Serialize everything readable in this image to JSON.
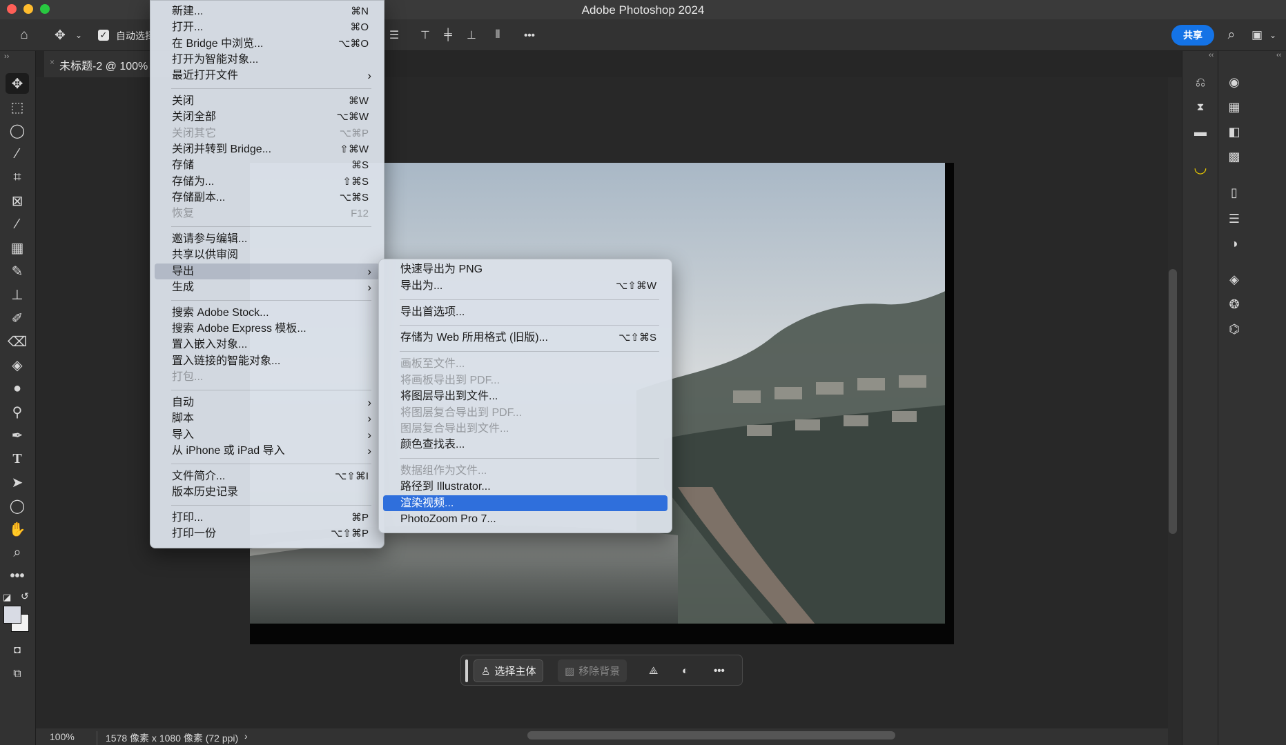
{
  "window": {
    "title": "Adobe Photoshop 2024"
  },
  "options_bar": {
    "auto_select_label": "自动选择",
    "more_label": "•••",
    "share_label": "共享"
  },
  "document_tab": {
    "title": "未标题-2 @ 100%"
  },
  "file_menu": {
    "items": [
      {
        "label": "新建...",
        "shortcut": "⌘N"
      },
      {
        "label": "打开...",
        "shortcut": "⌘O"
      },
      {
        "label": "在 Bridge 中浏览...",
        "shortcut": "⌥⌘O"
      },
      {
        "label": "打开为智能对象..."
      },
      {
        "label": "最近打开文件",
        "submenu": true
      },
      {
        "label": "关闭",
        "shortcut": "⌘W"
      },
      {
        "label": "关闭全部",
        "shortcut": "⌥⌘W"
      },
      {
        "label": "关闭其它",
        "shortcut": "⌥⌘P",
        "disabled": true
      },
      {
        "label": "关闭并转到 Bridge...",
        "shortcut": "⇧⌘W"
      },
      {
        "label": "存储",
        "shortcut": "⌘S"
      },
      {
        "label": "存储为...",
        "shortcut": "⇧⌘S"
      },
      {
        "label": "存储副本...",
        "shortcut": "⌥⌘S"
      },
      {
        "label": "恢复",
        "shortcut": "F12",
        "disabled": true
      },
      {
        "label": "邀请参与编辑..."
      },
      {
        "label": "共享以供审阅"
      },
      {
        "label": "导出",
        "submenu": true,
        "highlighted": true
      },
      {
        "label": "生成",
        "submenu": true
      },
      {
        "label": "搜索 Adobe Stock..."
      },
      {
        "label": "搜索 Adobe Express 模板..."
      },
      {
        "label": "置入嵌入对象..."
      },
      {
        "label": "置入链接的智能对象..."
      },
      {
        "label": "打包...",
        "disabled": true
      },
      {
        "label": "自动",
        "submenu": true
      },
      {
        "label": "脚本",
        "submenu": true
      },
      {
        "label": "导入",
        "submenu": true
      },
      {
        "label": "从 iPhone 或 iPad 导入",
        "submenu": true
      },
      {
        "label": "文件简介...",
        "shortcut": "⌥⇧⌘I"
      },
      {
        "label": "版本历史记录"
      },
      {
        "label": "打印...",
        "shortcut": "⌘P"
      },
      {
        "label": "打印一份",
        "shortcut": "⌥⇧⌘P"
      }
    ]
  },
  "export_menu": {
    "items": [
      {
        "label": "快速导出为 PNG"
      },
      {
        "label": "导出为...",
        "shortcut": "⌥⇧⌘W"
      },
      {
        "label": "导出首选项..."
      },
      {
        "label": "存储为 Web 所用格式 (旧版)...",
        "shortcut": "⌥⇧⌘S"
      },
      {
        "label": "画板至文件...",
        "disabled": true
      },
      {
        "label": "将画板导出到 PDF...",
        "disabled": true
      },
      {
        "label": "将图层导出到文件..."
      },
      {
        "label": "将图层复合导出到 PDF...",
        "disabled": true
      },
      {
        "label": "图层复合导出到文件...",
        "disabled": true
      },
      {
        "label": "颜色查找表..."
      },
      {
        "label": "数据组作为文件...",
        "disabled": true
      },
      {
        "label": "路径到 Illustrator..."
      },
      {
        "label": "渲染视频...",
        "selected": true
      },
      {
        "label": "PhotoZoom Pro 7..."
      }
    ]
  },
  "context_bar": {
    "select_subject_label": "选择主体",
    "remove_bg_label": "移除背景"
  },
  "status_bar": {
    "zoom": "100%",
    "doc_info": "1578 像素 x 1080 像素 (72 ppi)"
  },
  "colors": {
    "accent": "#1473e6",
    "menu_selected": "#2f6fdc"
  }
}
